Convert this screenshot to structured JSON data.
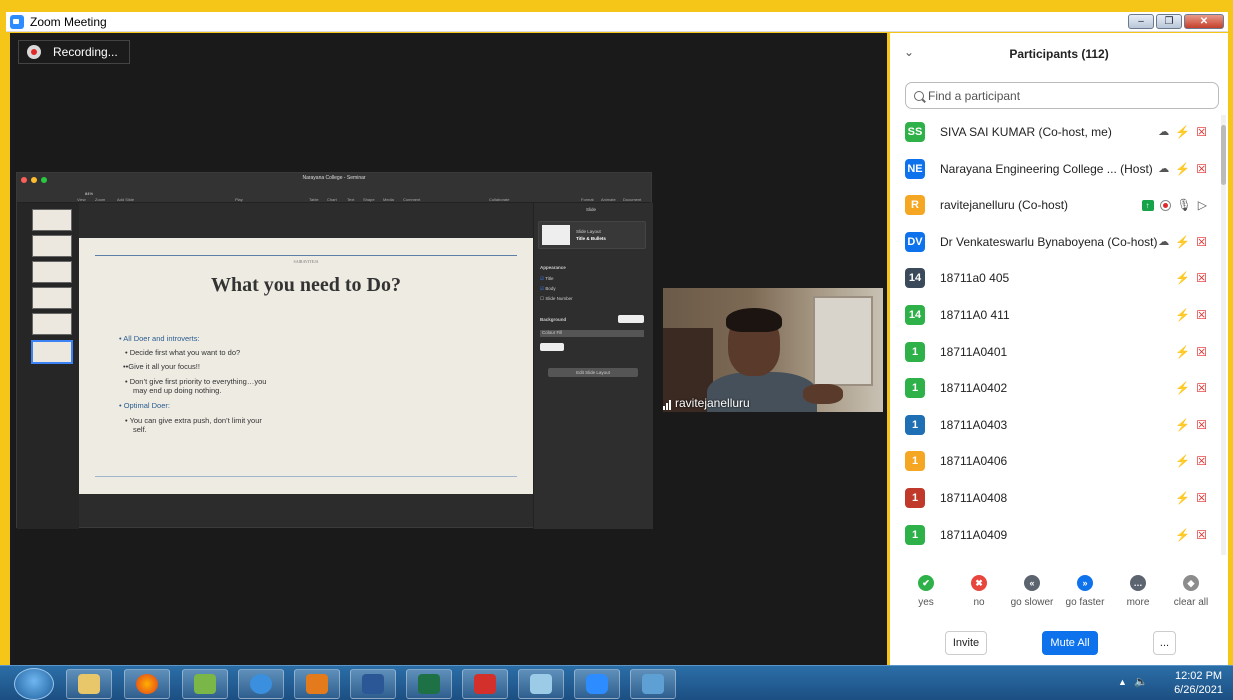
{
  "window": {
    "title": "Zoom Meeting",
    "minimize": "–",
    "restore": "❐",
    "close": "✕"
  },
  "recording": {
    "label": "Recording..."
  },
  "presentation": {
    "doc_title": "Narayana College - Seminar",
    "zoom": "84%",
    "toolbar_left": [
      "View",
      "Zoom",
      "Add Slide"
    ],
    "toolbar_mid": [
      "Play"
    ],
    "toolbar_insert": [
      "Table",
      "Chart",
      "Text",
      "Shape",
      "Media",
      "Comment"
    ],
    "toolbar_collab": [
      "Collaborate"
    ],
    "toolbar_right": [
      "Format",
      "Animate",
      "Document"
    ],
    "slide": {
      "author": "SAIRAVITEJA",
      "title": "What you need to Do?",
      "bullets": [
        "• All Doer  and introverts:",
        "• Decide first what you want to do?",
        "••Give it all your focus!!",
        "• Don’t give first priority to everything…you",
        "may end up doing nothing.",
        "• Optimal Doer:",
        "• You can give extra push, don’t limit your",
        "self."
      ]
    },
    "inspector": {
      "tab": "Slide",
      "layout_label": "Slide Layout",
      "layout_value": "Title & Bullets",
      "appearance": "Appearance",
      "options": [
        "Title",
        "Body",
        "Slide Number"
      ],
      "background": "Background",
      "fill": "Colour Fill",
      "edit_button": "Edit Slide Layout"
    }
  },
  "camera": {
    "name": "ravitejanelluru"
  },
  "participants_panel": {
    "title": "Participants (112)",
    "search_placeholder": "Find a participant",
    "participants": [
      {
        "initials": "SS",
        "color": "#2fb14a",
        "name": "SIVA SAI KUMAR (Co-host, me)",
        "cloud": true,
        "share": false
      },
      {
        "initials": "NE",
        "color": "#0e72ed",
        "name": "Narayana Engineering College ...  (Host)",
        "cloud": true,
        "share": false
      },
      {
        "initials": "R",
        "color": "#f5a623",
        "name": "ravitejanelluru (Co-host)",
        "cloud": false,
        "share": true
      },
      {
        "initials": "DV",
        "color": "#0e72ed",
        "name": "Dr Venkateswarlu Bynaboyena (Co-host)",
        "cloud": true,
        "share": false
      },
      {
        "initials": "14",
        "color": "#3b4a5a",
        "name": "18711a0 405",
        "cloud": false,
        "share": false
      },
      {
        "initials": "14",
        "color": "#2fb14a",
        "name": "18711A0 411",
        "cloud": false,
        "share": false
      },
      {
        "initials": "1",
        "color": "#2fb14a",
        "name": "18711A0401",
        "cloud": false,
        "share": false
      },
      {
        "initials": "1",
        "color": "#2fb14a",
        "name": "18711A0402",
        "cloud": false,
        "share": false
      },
      {
        "initials": "1",
        "color": "#1f6fb5",
        "name": "18711A0403",
        "cloud": false,
        "share": false
      },
      {
        "initials": "1",
        "color": "#f5a623",
        "name": "18711A0406",
        "cloud": false,
        "share": false
      },
      {
        "initials": "1",
        "color": "#c0392b",
        "name": "18711A0408",
        "cloud": false,
        "share": false
      },
      {
        "initials": "1",
        "color": "#2fb14a",
        "name": "18711A0409",
        "cloud": false,
        "share": false
      }
    ],
    "reactions": [
      {
        "label": "yes",
        "glyph": "✔",
        "color": "#2fb14a"
      },
      {
        "label": "no",
        "glyph": "✖",
        "color": "#e8453c"
      },
      {
        "label": "go slower",
        "glyph": "«",
        "color": "#5c6470"
      },
      {
        "label": "go faster",
        "glyph": "»",
        "color": "#0e72ed"
      },
      {
        "label": "more",
        "glyph": "…",
        "color": "#5c6470"
      },
      {
        "label": "clear all",
        "glyph": "◆",
        "color": "#8c8c8c"
      }
    ],
    "invite": "Invite",
    "mute_all": "Mute All",
    "more": "..."
  },
  "taskbar": {
    "time": "12:02 PM",
    "date": "6/26/2021"
  }
}
